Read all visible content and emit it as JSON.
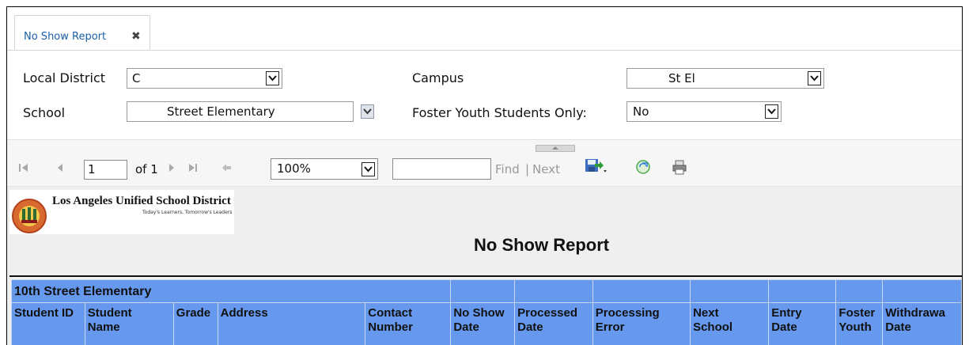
{
  "tab": {
    "label": "No Show Report",
    "close_icon": "close-icon"
  },
  "params": {
    "local_district": {
      "label": "Local District",
      "value": "C"
    },
    "campus": {
      "label": "Campus",
      "value": "St El"
    },
    "school": {
      "label": "School",
      "value": "Street Elementary"
    },
    "foster": {
      "label": "Foster Youth Students Only:",
      "value": "No"
    }
  },
  "toolbar": {
    "page_value": "1",
    "of_label": "of 1",
    "zoom": "100%",
    "find_label": "Find",
    "separator": "|",
    "next_label": "Next",
    "icons": [
      "first-page-icon",
      "previous-page-icon",
      "next-page-icon",
      "last-page-icon",
      "back-icon",
      "export-icon",
      "refresh-icon",
      "print-icon"
    ]
  },
  "report": {
    "logo_text": "Los Angeles Unified School District",
    "logo_tagline": "Today's Learners, Tomorrow's Leaders",
    "title": "No Show Report",
    "group_name": "10th Street Elementary",
    "columns": [
      [
        "Student ID"
      ],
      [
        "Student",
        "Name"
      ],
      [
        "Grade"
      ],
      [
        "Address"
      ],
      [
        "Contact",
        "Number"
      ],
      [
        "No Show",
        "Date"
      ],
      [
        "Processed",
        "Date"
      ],
      [
        "Processing",
        "Error"
      ],
      [
        "Next",
        "School"
      ],
      [
        "Entry",
        "Date"
      ],
      [
        "Foster",
        "Youth"
      ],
      [
        "Withdrawa",
        "Date"
      ]
    ]
  },
  "colors": {
    "header_blue": "#6699ee",
    "tab_text": "#1a5fa8",
    "toolbar_bg": "#f6f6f6"
  }
}
